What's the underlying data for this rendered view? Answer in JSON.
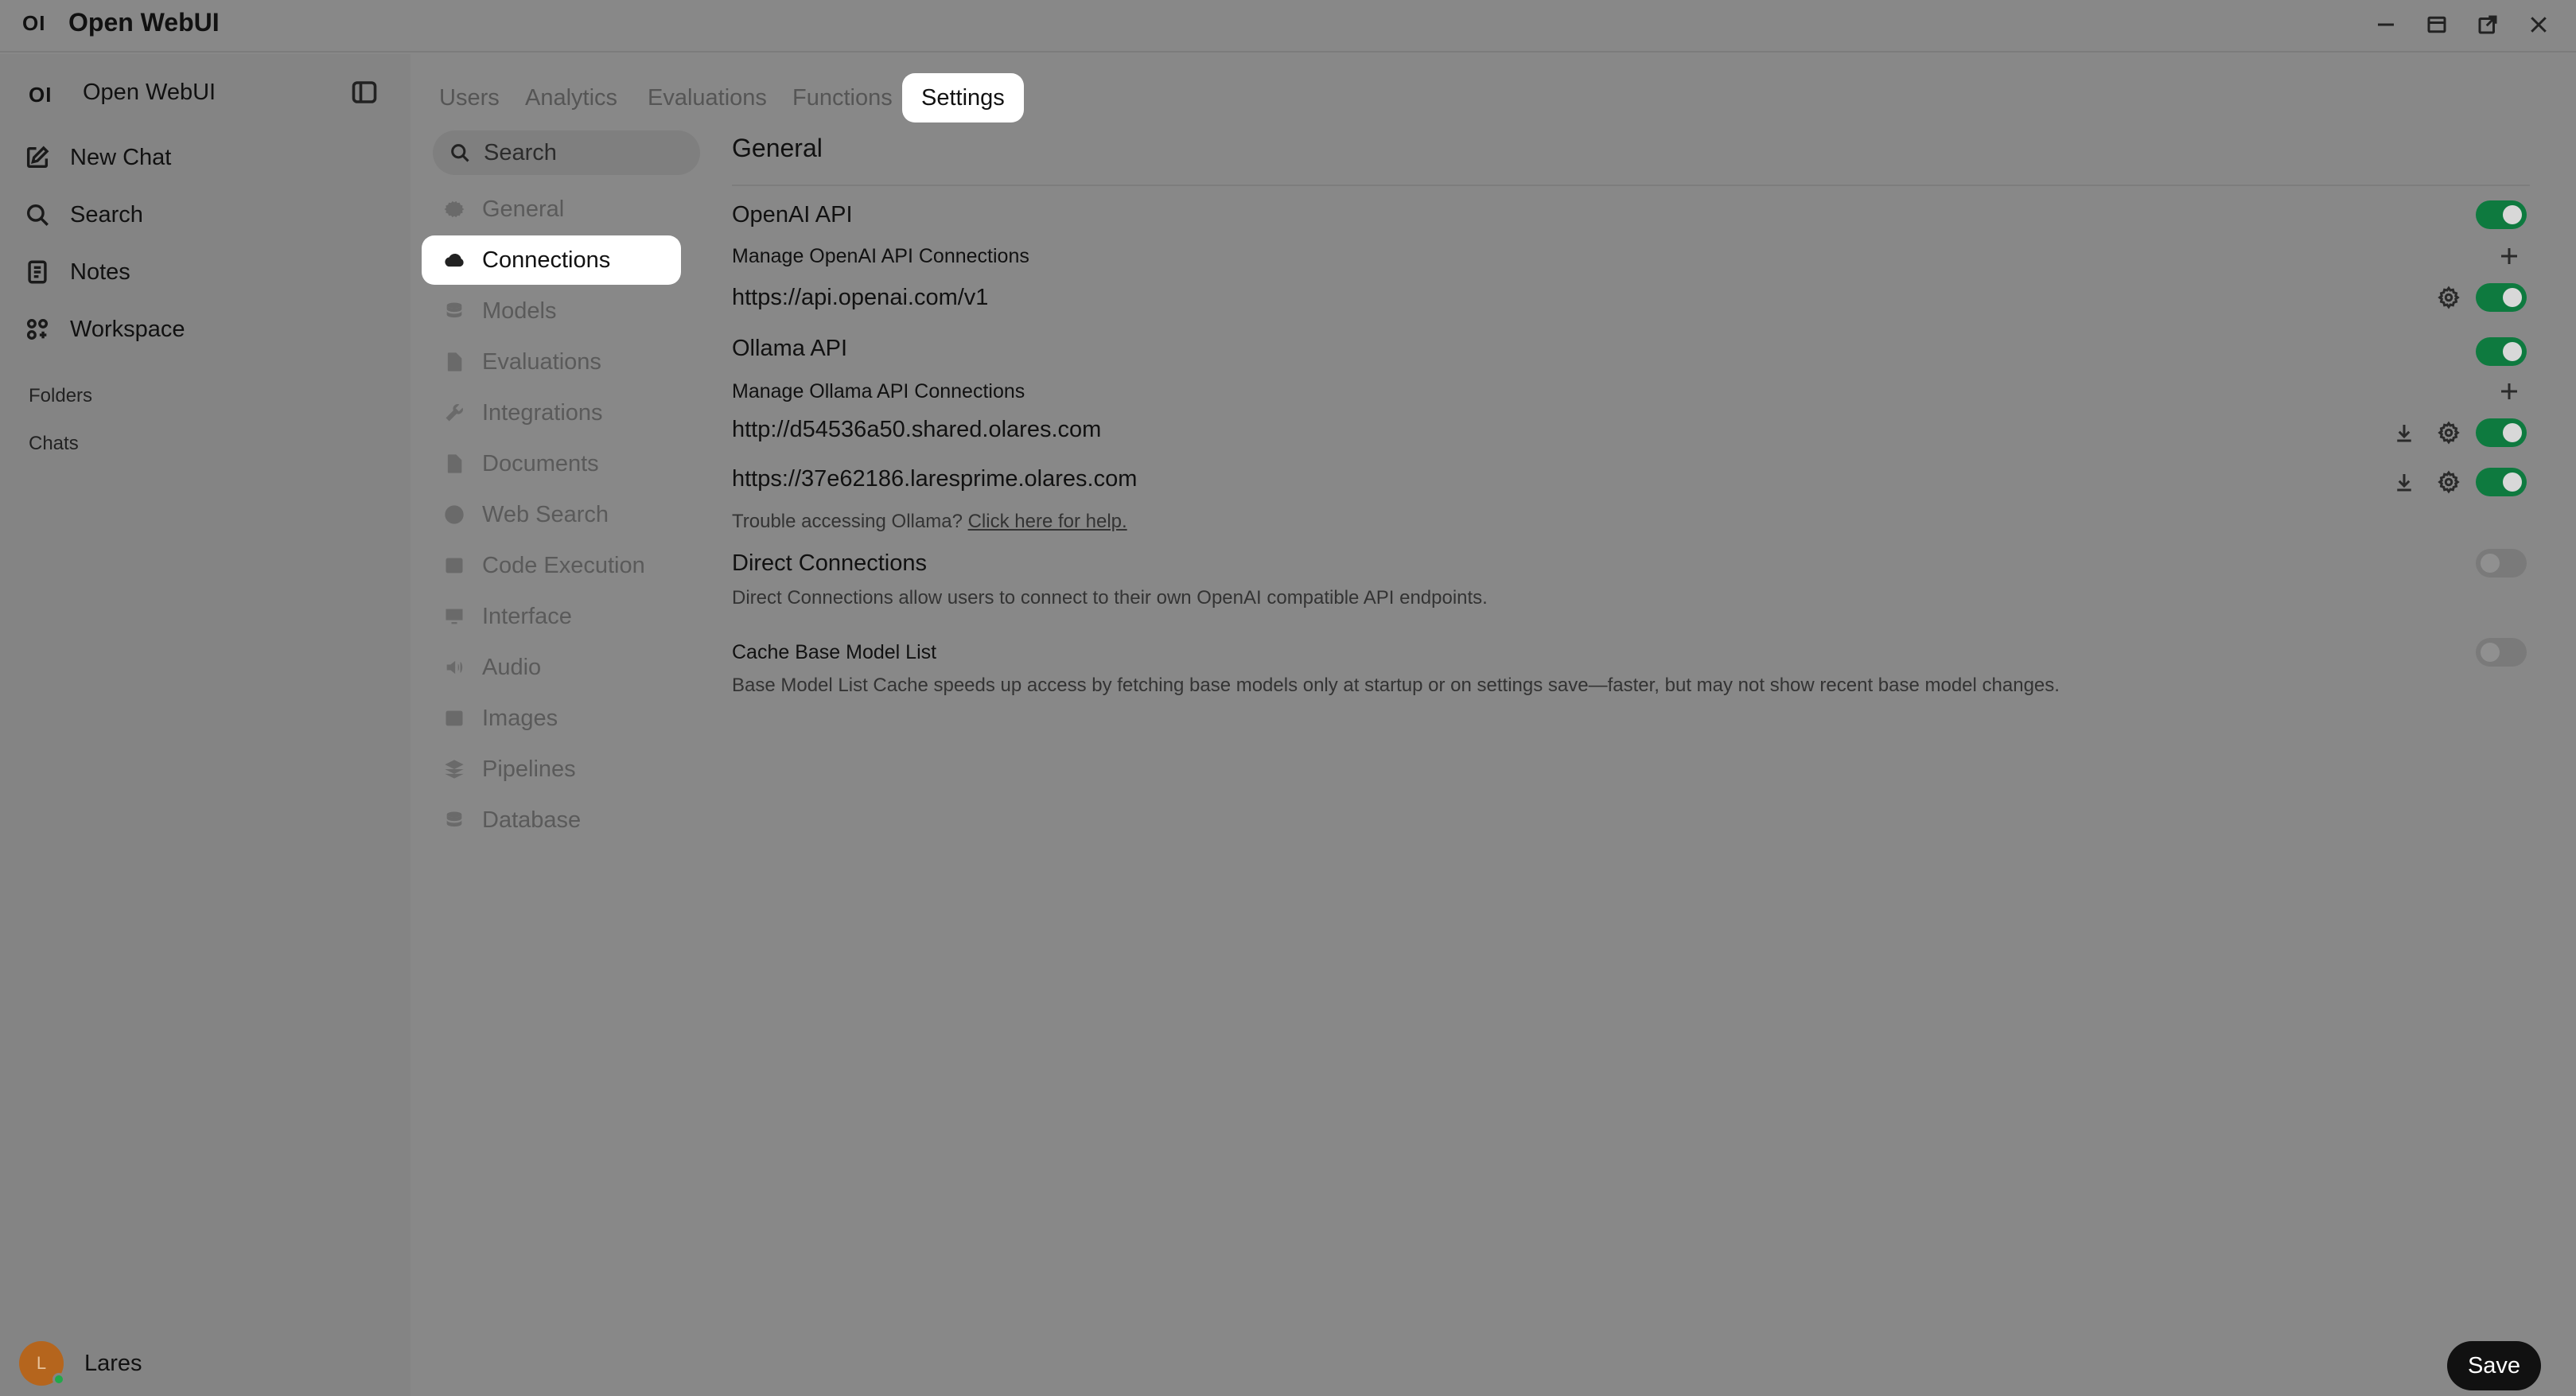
{
  "window": {
    "logo": "OI",
    "title": "Open WebUI"
  },
  "sidebar": {
    "logo": "OI",
    "title": "Open WebUI",
    "items": [
      {
        "label": "New Chat",
        "icon": "pencil-square-icon"
      },
      {
        "label": "Search",
        "icon": "search-icon"
      },
      {
        "label": "Notes",
        "icon": "notes-icon"
      },
      {
        "label": "Workspace",
        "icon": "workspace-icon"
      }
    ],
    "sections": [
      "Folders",
      "Chats"
    ],
    "user": {
      "initial": "L",
      "name": "Lares"
    }
  },
  "tabs": [
    "Users",
    "Analytics",
    "Evaluations",
    "Functions",
    "Settings"
  ],
  "active_tab": "Settings",
  "settings_menu": {
    "search_placeholder": "Search",
    "items": [
      "General",
      "Connections",
      "Models",
      "Evaluations",
      "Integrations",
      "Documents",
      "Web Search",
      "Code Execution",
      "Interface",
      "Audio",
      "Images",
      "Pipelines",
      "Database"
    ],
    "active": "Connections"
  },
  "main": {
    "title": "General",
    "openai": {
      "title": "OpenAI API",
      "enabled": true,
      "manage_label": "Manage OpenAI API Connections",
      "connections": [
        {
          "url": "https://api.openai.com/v1",
          "enabled": true
        }
      ]
    },
    "ollama": {
      "title": "Ollama API",
      "enabled": true,
      "manage_label": "Manage Ollama API Connections",
      "connections": [
        {
          "url": "http://d54536a50.shared.olares.com",
          "enabled": true
        },
        {
          "url": "https://37e62186.laresprime.olares.com",
          "enabled": true
        }
      ],
      "help_text": "Trouble accessing Ollama?",
      "help_link": "Click here for help."
    },
    "direct": {
      "title": "Direct Connections",
      "enabled": false,
      "description": "Direct Connections allow users to connect to their own OpenAI compatible API endpoints."
    },
    "cache": {
      "title": "Cache Base Model List",
      "enabled": false,
      "description": "Base Model List Cache speeds up access by fetching base models only at startup or on settings save—faster, but may not show recent base model changes."
    },
    "save_label": "Save"
  },
  "colors": {
    "toggle_on": "#0e7a3f",
    "background": "#888888"
  }
}
